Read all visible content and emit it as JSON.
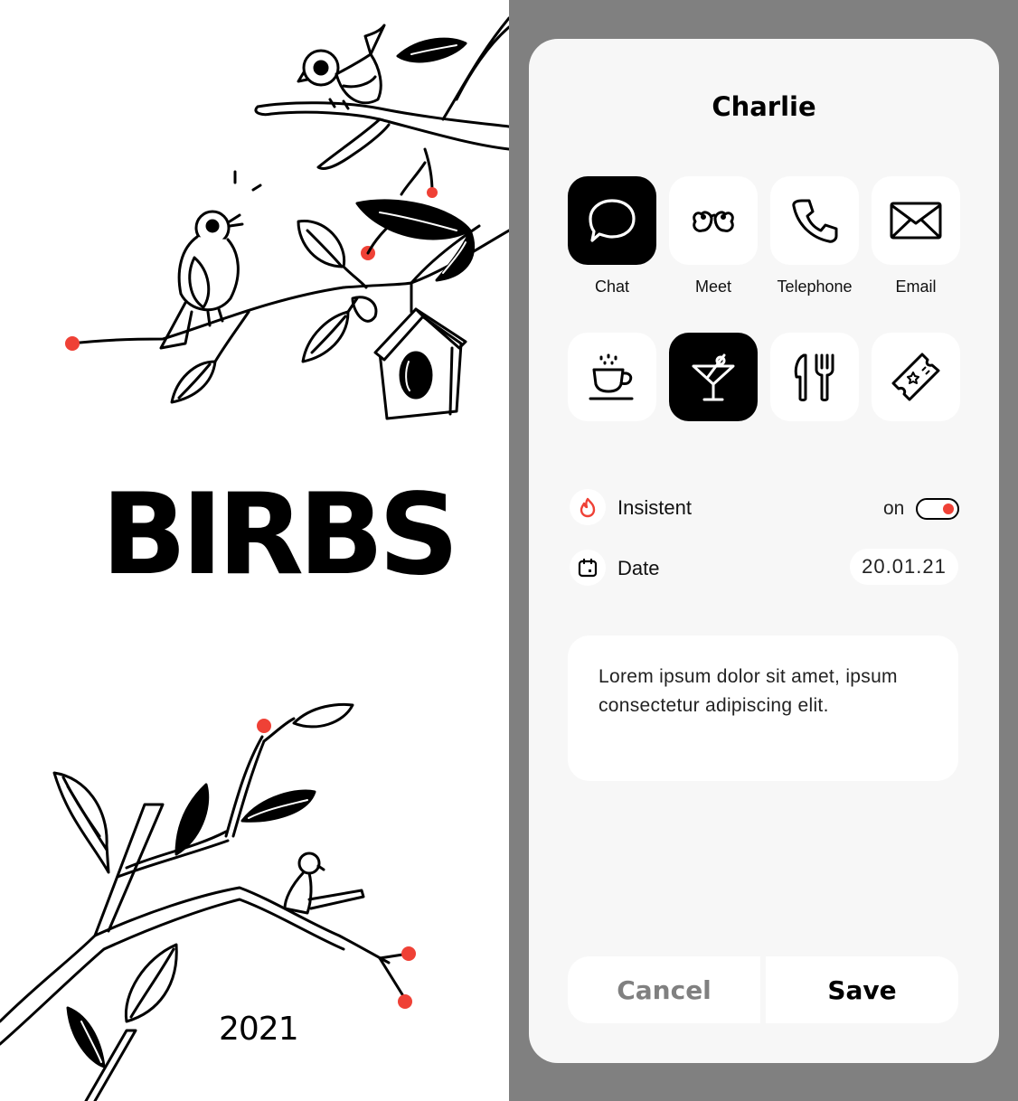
{
  "illustration": {
    "brand": "BIRBS",
    "year": "2021",
    "accent": "#ef4136"
  },
  "card": {
    "title": "Charlie",
    "options": [
      {
        "label": "Chat",
        "icon": "chat-bubble-icon",
        "selected": true
      },
      {
        "label": "Meet",
        "icon": "birds-meet-icon",
        "selected": false
      },
      {
        "label": "Telephone",
        "icon": "phone-icon",
        "selected": false
      },
      {
        "label": "Email",
        "icon": "envelope-icon",
        "selected": false
      }
    ],
    "places": [
      {
        "icon": "coffee-cup-icon",
        "selected": false
      },
      {
        "icon": "cocktail-icon",
        "selected": true
      },
      {
        "icon": "knife-fork-icon",
        "selected": false
      },
      {
        "icon": "ticket-icon",
        "selected": false
      }
    ],
    "insistent": {
      "label": "Insistent",
      "state": "on",
      "icon": "flame-icon"
    },
    "date": {
      "label": "Date",
      "value": "20.01.21",
      "icon": "calendar-icon"
    },
    "note": "Lorem ipsum dolor sit amet, ipsum consectetur adipiscing elit.",
    "cancel_label": "Cancel",
    "save_label": "Save"
  },
  "colors": {
    "panel_bg": "#808080",
    "card_bg": "#f7f7f7",
    "accent": "#ef4136"
  }
}
